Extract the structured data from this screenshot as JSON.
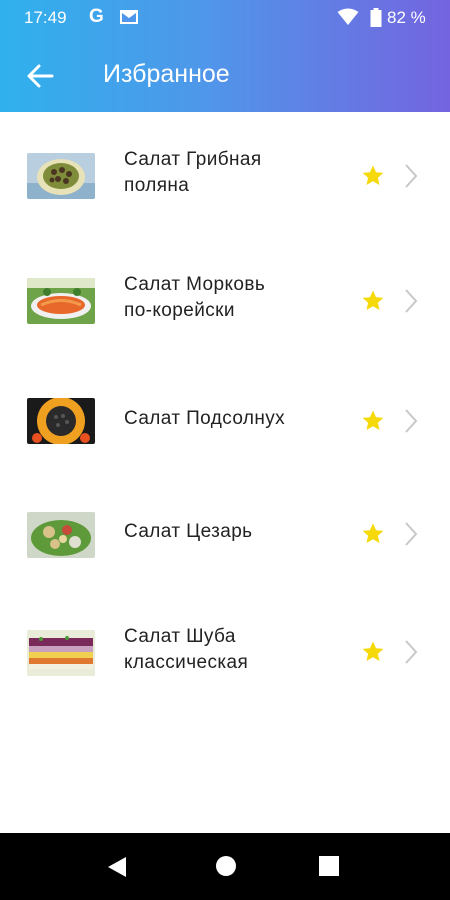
{
  "status_bar": {
    "time": "17:49",
    "g_label": "G",
    "battery_percent": "82 %"
  },
  "app_bar": {
    "title": "Избранное",
    "back_icon": "arrow-left-icon"
  },
  "items": [
    {
      "title_line1": "Салат Грибная",
      "title_line2": "поляна",
      "favorite": true
    },
    {
      "title_line1": "Салат Морковь",
      "title_line2": "по-корейски",
      "favorite": true
    },
    {
      "title_line1": "Салат Подсолнух",
      "title_line2": "",
      "favorite": true
    },
    {
      "title_line1": "Салат Цезарь",
      "title_line2": "",
      "favorite": true
    },
    {
      "title_line1": "Салат Шуба",
      "title_line2": "классическая",
      "favorite": true
    }
  ],
  "colors": {
    "appbar_start": "#2fb1ec",
    "appbar_end": "#7464df",
    "star": "#f5d90a",
    "chevron": "#c8c8c8"
  }
}
